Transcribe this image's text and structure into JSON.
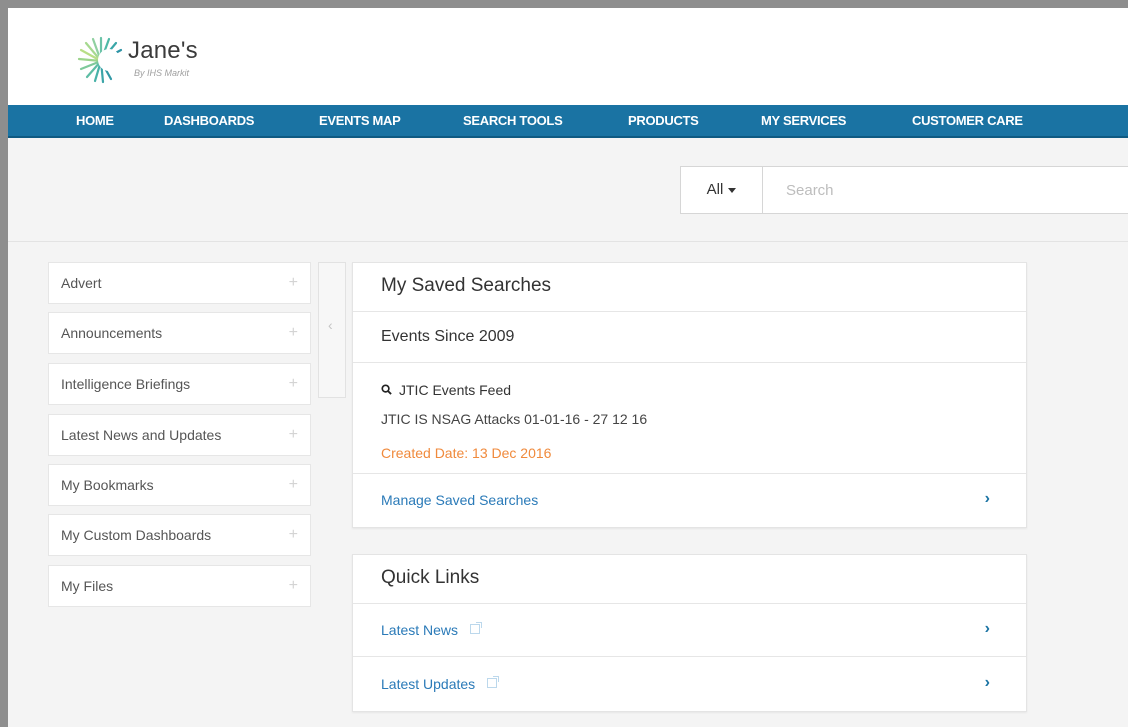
{
  "brand": {
    "name": "Jane's",
    "tagline": "By IHS Markit"
  },
  "nav": {
    "items": [
      {
        "label": "HOME"
      },
      {
        "label": "DASHBOARDS"
      },
      {
        "label": "EVENTS MAP"
      },
      {
        "label": "SEARCH TOOLS"
      },
      {
        "label": "PRODUCTS"
      },
      {
        "label": "MY SERVICES"
      },
      {
        "label": "CUSTOMER CARE"
      }
    ]
  },
  "search": {
    "scope_label": "All",
    "placeholder": "Search",
    "value": ""
  },
  "sidebar": {
    "items": [
      {
        "label": "Advert"
      },
      {
        "label": "Announcements"
      },
      {
        "label": "Intelligence Briefings"
      },
      {
        "label": "Latest News and Updates"
      },
      {
        "label": "My Bookmarks"
      },
      {
        "label": "My Custom Dashboards"
      },
      {
        "label": "My Files"
      }
    ],
    "collapse_glyph": "‹"
  },
  "saved_searches": {
    "title": "My Saved Searches",
    "group_title": "Events Since 2009",
    "feed_name": "JTIC Events Feed",
    "search_name": "JTIC IS NSAG Attacks 01-01-16 - 27 12 16",
    "created_label": "Created Date: 13 Dec 2016",
    "manage_label": "Manage Saved Searches"
  },
  "quick_links": {
    "title": "Quick Links",
    "items": [
      {
        "label": "Latest News"
      },
      {
        "label": "Latest Updates"
      }
    ]
  },
  "colors": {
    "nav_bg": "#1a73a3",
    "link": "#2a7ab8",
    "created_date": "#f08a3c"
  }
}
